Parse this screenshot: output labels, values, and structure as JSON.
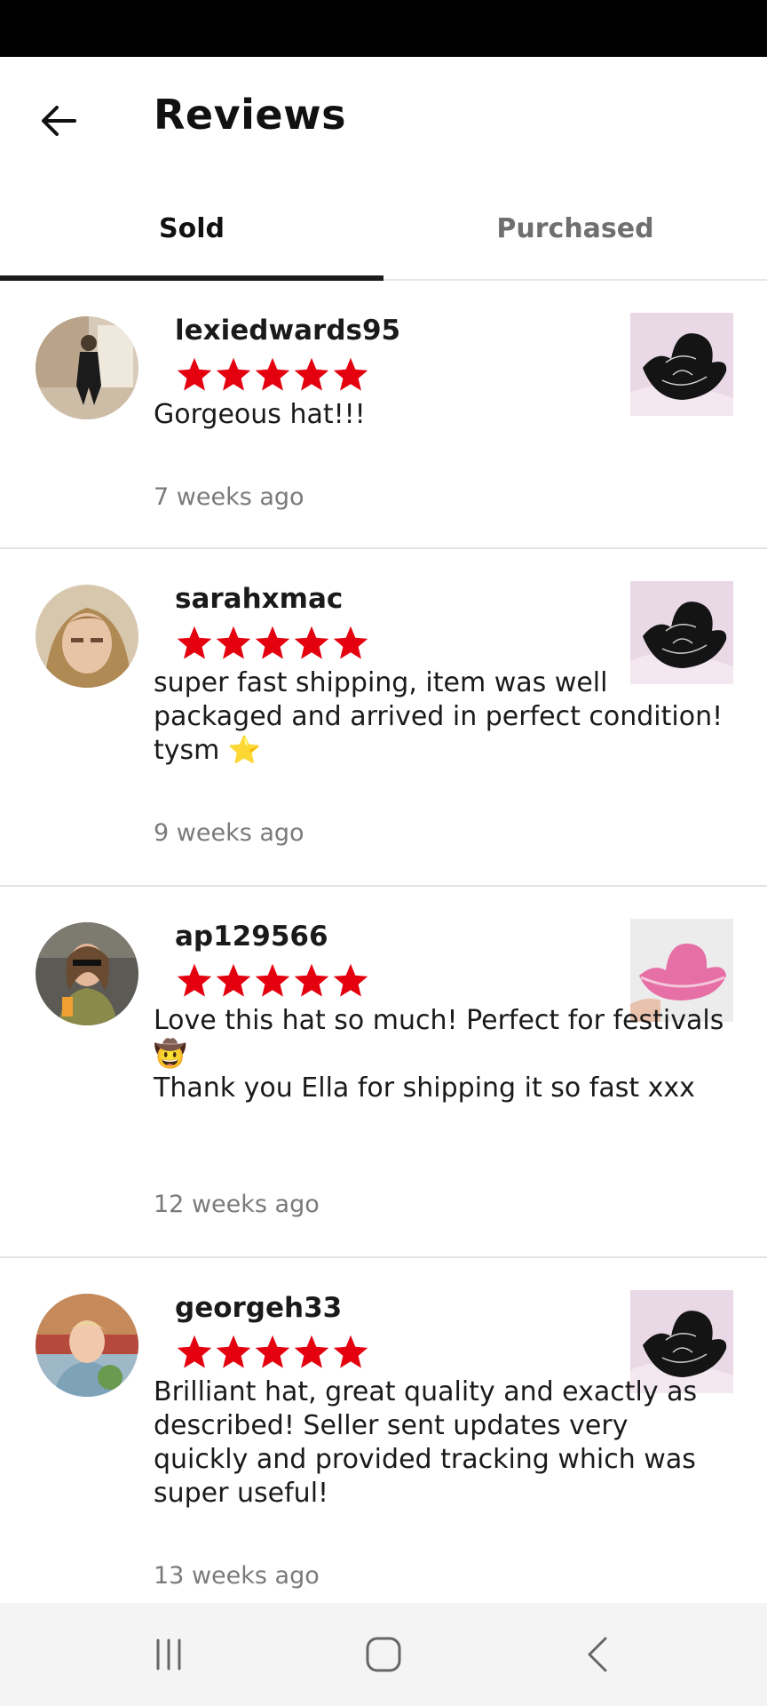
{
  "header": {
    "title": "Reviews"
  },
  "tabs": [
    {
      "label": "Sold",
      "active": true
    },
    {
      "label": "Purchased",
      "active": false
    }
  ],
  "reviews": [
    {
      "username": "lexiedwards95",
      "rating": 5,
      "comment": "Gorgeous hat!!!",
      "time": "7 weeks ago",
      "item": "black cowboy hat"
    },
    {
      "username": "sarahxmac",
      "rating": 5,
      "comment": "super fast shipping, item was well packaged and arrived in perfect condition! tysm ⭐",
      "time": "9 weeks ago",
      "item": "black cowboy hat"
    },
    {
      "username": "ap129566",
      "rating": 5,
      "comment": "Love this hat so much! Perfect for festivals 🤠\nThank you Ella for shipping it so fast xxx",
      "time": "12 weeks ago",
      "item": "pink cowboy hat"
    },
    {
      "username": "georgeh33",
      "rating": 5,
      "comment": "Brilliant hat, great quality and exactly as described! Seller sent updates very quickly and provided tracking which was super useful!",
      "time": "13 weeks ago",
      "item": "black cowboy hat"
    }
  ],
  "colors": {
    "star": "#e4000f",
    "tab_indicator": "#1c1c1c",
    "inactive_tab": "#6f6f6f"
  },
  "icons": {
    "back": "arrow-left-icon",
    "nav_recents": "recents-icon",
    "nav_home": "home-icon",
    "nav_back": "chevron-left-icon"
  }
}
